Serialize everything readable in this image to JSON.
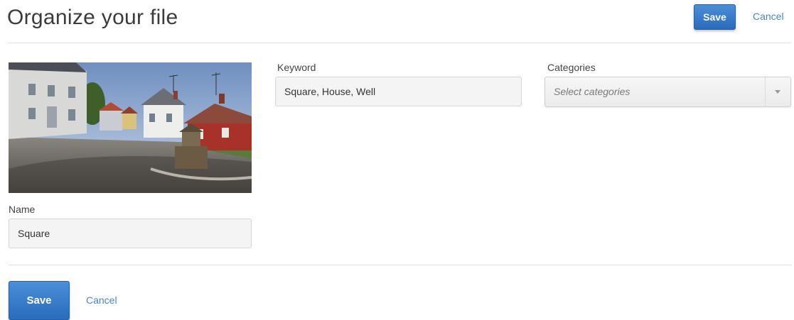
{
  "header": {
    "title": "Organize your file",
    "save_label": "Save",
    "cancel_label": "Cancel"
  },
  "form": {
    "name": {
      "label": "Name",
      "value": "Square"
    },
    "keyword": {
      "label": "Keyword",
      "value": "Square, House, Well"
    },
    "categories": {
      "label": "Categories",
      "placeholder": "Select categories",
      "icon": "chevron-down-icon"
    }
  },
  "footer": {
    "save_label": "Save",
    "cancel_label": "Cancel"
  },
  "colors": {
    "accent": "#2a6bbd",
    "link": "#4a86c5"
  }
}
